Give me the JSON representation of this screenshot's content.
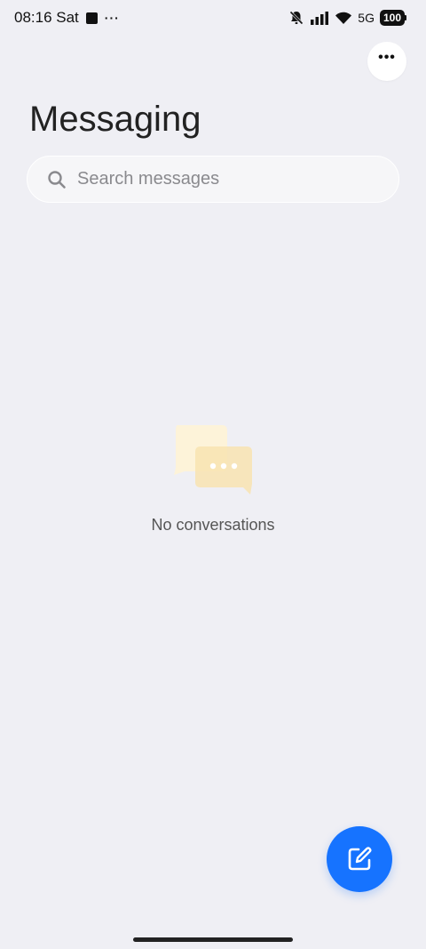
{
  "status_bar": {
    "time": "08:16 Sat",
    "more_notifications": "···",
    "network": "5G",
    "battery": "100"
  },
  "header": {
    "title": "Messaging"
  },
  "search": {
    "placeholder": "Search messages"
  },
  "empty_state": {
    "text": "No conversations"
  },
  "icons": {
    "more": "more-options-icon",
    "search": "search-icon",
    "empty": "chat-bubbles-icon",
    "compose": "compose-icon"
  },
  "colors": {
    "background": "#efeff4",
    "accent": "#1673ff",
    "empty_icon_light": "#fdf3d9",
    "empty_icon_dark": "#f8e3b0"
  }
}
